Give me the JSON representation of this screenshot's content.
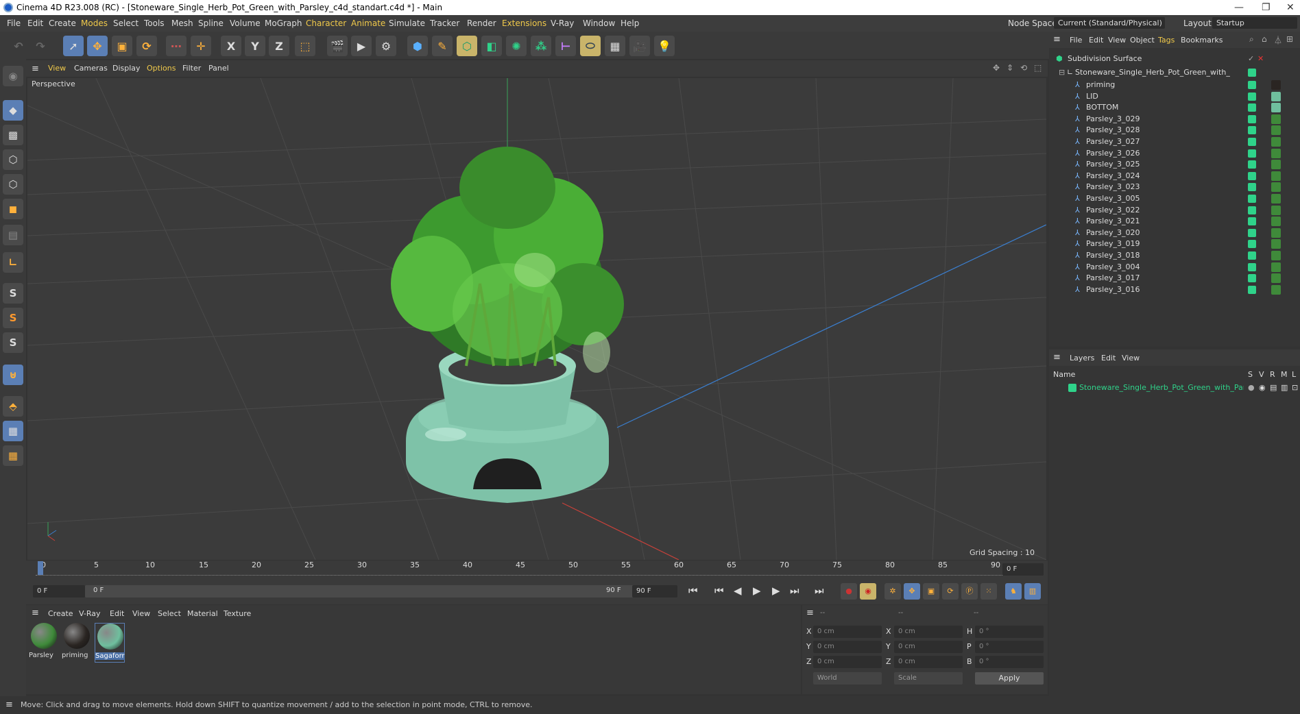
{
  "title": "Cinema 4D R23.008 (RC) - [Stoneware_Single_Herb_Pot_Green_with_Parsley_c4d_standart.c4d *] - Main",
  "menu": [
    "File",
    "Edit",
    "Create",
    "Modes",
    "Select",
    "Tools",
    "Mesh",
    "Spline",
    "Volume",
    "MoGraph",
    "Character",
    "Animate",
    "Simulate",
    "Tracker",
    "Render",
    "Extensions",
    "V-Ray",
    "Window",
    "Help"
  ],
  "node_space_label": "Node Space:",
  "node_space_value": "Current (Standard/Physical)",
  "layout_label": "Layout:",
  "layout_value": "Startup",
  "toolbar_axis": [
    "X",
    "Y",
    "Z"
  ],
  "viewport": {
    "menu": [
      "View",
      "Cameras",
      "Display",
      "Options",
      "Filter",
      "Panel"
    ],
    "label": "Perspective",
    "grid_spacing": "Grid Spacing : 10 cm"
  },
  "left_tool_letters": [
    "S",
    "S",
    "S"
  ],
  "timeline": {
    "ticks": [
      "0",
      "5",
      "10",
      "15",
      "20",
      "25",
      "30",
      "35",
      "40",
      "45",
      "50",
      "55",
      "60",
      "65",
      "70",
      "75",
      "80",
      "85",
      "90"
    ],
    "current_frame": "0 F",
    "start": "0 F",
    "range_start": "0 F",
    "range_end": "90 F",
    "end": "90 F"
  },
  "material_panel": {
    "menu": [
      "Create",
      "V-Ray",
      "Edit",
      "View",
      "Select",
      "Material",
      "Texture"
    ],
    "materials": [
      {
        "label": "Parsley",
        "color": "#3f8a3a"
      },
      {
        "label": "priming",
        "color": "#2a2522"
      },
      {
        "label": "Sagaforr",
        "color": "#6fbf9e"
      }
    ]
  },
  "coord_panel": {
    "headers": [
      "--",
      "--",
      "--"
    ],
    "rows": [
      {
        "a": "X",
        "av": "0 cm",
        "b": "X",
        "bv": "0 cm",
        "c": "H",
        "cv": "0 °"
      },
      {
        "a": "Y",
        "av": "0 cm",
        "b": "Y",
        "bv": "0 cm",
        "c": "P",
        "cv": "0 °"
      },
      {
        "a": "Z",
        "av": "0 cm",
        "b": "Z",
        "bv": "0 cm",
        "c": "B",
        "cv": "0 °"
      }
    ],
    "world": "World",
    "scale": "Scale",
    "apply": "Apply"
  },
  "status": "Move: Click and drag to move elements. Hold down SHIFT to quantize movement / add to the selection in point mode, CTRL to remove.",
  "object_manager": {
    "menu": [
      "File",
      "Edit",
      "View",
      "Object",
      "Tags",
      "Bookmarks"
    ],
    "root": "Subdivision Surface",
    "group": "Stoneware_Single_Herb_Pot_Green_with_Parsley",
    "children": [
      "priming",
      "LID",
      "BOTTOM",
      "Parsley_3_029",
      "Parsley_3_028",
      "Parsley_3_027",
      "Parsley_3_026",
      "Parsley_3_025",
      "Parsley_3_024",
      "Parsley_3_023",
      "Parsley_3_005",
      "Parsley_3_022",
      "Parsley_3_021",
      "Parsley_3_020",
      "Parsley_3_019",
      "Parsley_3_018",
      "Parsley_3_004",
      "Parsley_3_017",
      "Parsley_3_016"
    ]
  },
  "layer_manager": {
    "menu": [
      "Layers",
      "Edit",
      "View"
    ],
    "name_header": "Name",
    "cols": [
      "S",
      "V",
      "R",
      "M",
      "L"
    ],
    "layer": "Stoneware_Single_Herb_Pot_Green_with_Parsley"
  },
  "colors": {
    "accent": "#f0c94a",
    "selected": "#5b7fb5",
    "layer": "#2fd38a"
  }
}
